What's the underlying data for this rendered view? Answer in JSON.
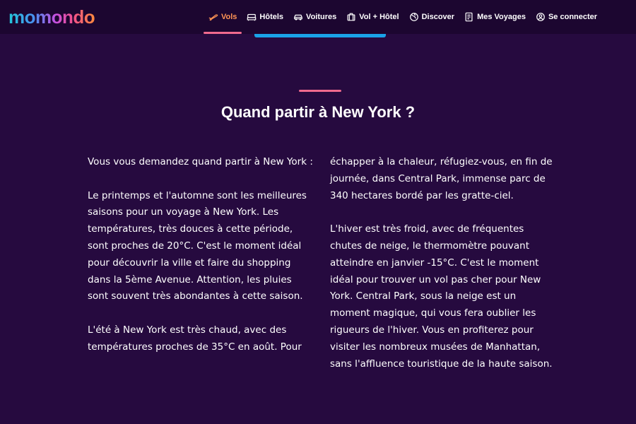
{
  "header": {
    "logo_text": "momondo",
    "nav": [
      {
        "label": "Vols",
        "icon": "plane-icon",
        "active": true
      },
      {
        "label": "Hôtels",
        "icon": "bed-icon",
        "active": false
      },
      {
        "label": "Voitures",
        "icon": "car-icon",
        "active": false
      },
      {
        "label": "Vol + Hôtel",
        "icon": "suitcase-icon",
        "active": false
      },
      {
        "label": "Discover",
        "icon": "globe-icon",
        "active": false
      },
      {
        "label": "Mes Voyages",
        "icon": "trips-icon",
        "active": false
      },
      {
        "label": "Se connecter",
        "icon": "user-icon",
        "active": false
      }
    ]
  },
  "section": {
    "title": "Quand partir à New York ?",
    "left_paragraphs": [
      "Vous vous demandez quand partir à New York :",
      "Le printemps et l'automne sont les meilleures saisons pour un voyage à New York. Les températures, très douces à cette période, sont proches de 20°C. C'est le moment idéal pour découvrir la ville et faire du shopping dans la 5ème Avenue. Attention, les pluies sont souvent très abondantes à cette saison.",
      "L'été à New York est très chaud, avec des températures proches de 35°C en août. Pour"
    ],
    "right_paragraphs": [
      "échapper à la chaleur, réfugiez-vous, en fin de journée, dans Central Park, immense parc de 340 hectares bordé par les gratte-ciel.",
      "L'hiver est très froid, avec de fréquentes chutes de neige, le thermomètre pouvant atteindre en janvier -15°C. C'est le moment idéal pour trouver un vol pas cher pour New York. Central Park, sous la neige est un moment magique, qui vous fera oublier les rigueurs de l'hiver. Vous en profiterez pour visiter les nombreux musées de Manhattan, sans l'affluence touristique de la haute saison."
    ]
  },
  "colors": {
    "background": "#260a3f",
    "topbar": "#1c0630",
    "active_nav": "#ff9455",
    "accent_pink": "#f06a8e",
    "accent_blue": "#1aa3e8"
  }
}
